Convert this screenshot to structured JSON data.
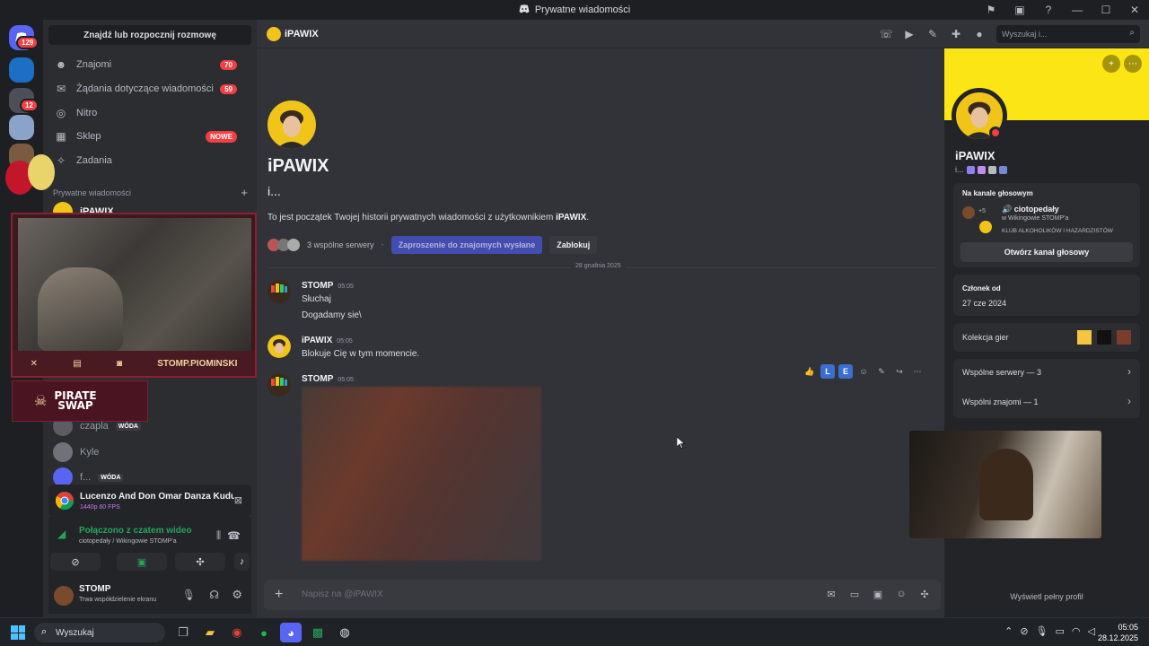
{
  "window": {
    "title": "Prywatne wiadomości"
  },
  "rail": {
    "home_badge": "129",
    "server_badge": "12"
  },
  "sidebar": {
    "find_label": "Znajdź lub rozpocznij rozmowę",
    "nav": [
      {
        "label": "Znajomi",
        "count": "70",
        "icon": "friends-icon"
      },
      {
        "label": "Żądania dotyczące wiadomości",
        "count": "59",
        "icon": "mail-icon"
      },
      {
        "label": "Nitro",
        "icon": "nitro-icon"
      },
      {
        "label": "Sklep",
        "tag": "NOWE",
        "icon": "shop-icon"
      },
      {
        "label": "Zadania",
        "icon": "quests-icon"
      }
    ],
    "dm_header": "Prywatne wiadomości",
    "dm_add": "+",
    "dms": [
      {
        "name": "iPAWIX"
      },
      {
        "name": "czapla",
        "tag": "WÓDA"
      },
      {
        "name": "Kyle"
      },
      {
        "name": "f...",
        "tag": "WÓDA"
      }
    ]
  },
  "stream_overlay": {
    "handle": "STOMP.PIOMINSKI",
    "brand": "PIRATE SWAP",
    "brand_line1": "PIRATE",
    "brand_line2": "SWAP"
  },
  "now_playing": {
    "title": "Lucenzo And Don Omar Danza Kuduro - You...",
    "quality": "1440p 60 FPS"
  },
  "voice": {
    "status": "Połączono z czatem wideo",
    "channel": "ciotopedały / Wikingowie STOMP'a"
  },
  "user": {
    "name": "STOMP",
    "status": "Trwa współdzielenie ekranu"
  },
  "header": {
    "name": "iPAWIX",
    "search_placeholder": "Wyszukaj i..."
  },
  "chat": {
    "title": "iPAWIX",
    "subtitle": "i...",
    "intro_prefix": "To jest początek Twojej historii prywatnych wiadomości z użytkownikiem ",
    "intro_name": "iPAWIX",
    "intro_suffix": ".",
    "mutual_servers": "3 wspólne serwery",
    "invite_sent": "Zaproszenie do znajomych wysłane",
    "block": "Zablokuj",
    "date_divider": "28 grudnia 2025",
    "messages": [
      {
        "author": "STOMP",
        "time": "05:05",
        "lines": [
          "Słuchaj",
          "Dogadamy sie\\"
        ]
      },
      {
        "author": "iPAWIX",
        "time": "05:05",
        "lines": [
          "Blokuje Cię w tym momencie."
        ]
      },
      {
        "author": "STOMP",
        "time": "05:05",
        "lines": []
      }
    ],
    "composer_placeholder": "Napisz na @iPAWIX"
  },
  "profile": {
    "name": "iPAWIX",
    "tag": "i...",
    "voice_label": "Na kanale głosowym",
    "voice_channel": "ciotopedały",
    "voice_server": "w Wikingowie STOMP'a",
    "voice_extra": "+5",
    "voice_sub": "KLUB ALKOHOLIKÓW I HAZARDZISTÓW",
    "open_voice": "Otwórz kanał głosowy",
    "member_since_label": "Członek od",
    "member_since": "27 cze 2024",
    "games_label": "Kolekcja gier",
    "mutual_servers": "Wspólne serwery — 3",
    "mutual_friends": "Wspólni znajomi — 1",
    "full_profile": "Wyświetl pełny profil"
  },
  "taskbar": {
    "search": "Wyszukaj",
    "time": "05:05",
    "date": "28.12.2025"
  },
  "colors": {
    "accent": "#5865f2",
    "dnd": "#f23f43",
    "online": "#23a55a",
    "banner": "#fce514"
  }
}
